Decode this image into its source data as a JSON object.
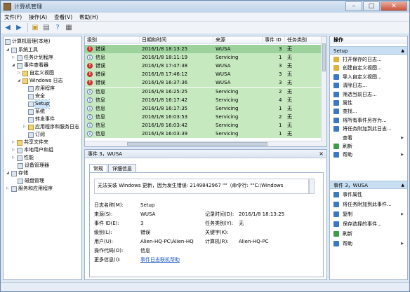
{
  "window": {
    "title": "计算机管理",
    "min": "–",
    "max": "□",
    "close": "✕"
  },
  "menu": [
    "文件(F)",
    "操作(A)",
    "查看(V)",
    "帮助(H)"
  ],
  "toolbar": [
    "back-icon",
    "forward-icon",
    "up-folder-icon",
    "show-hide-tree-icon",
    "help-icon",
    "properties-icon"
  ],
  "tree": {
    "root": "计算机管理(本地)",
    "system_tools": "系统工具",
    "task_scheduler": "任务计划程序",
    "event_viewer": "事件查看器",
    "custom_views": "自定义视图",
    "windows_logs": "Windows 日志",
    "application": "应用程序",
    "security": "安全",
    "setup": "Setup",
    "system": "系统",
    "forwarded": "转发事件",
    "app_service_logs": "应用程序和服务日志",
    "subscriptions": "订阅",
    "shared_folders": "共享文件夹",
    "local_users": "本地用户和组",
    "performance": "性能",
    "device_manager": "设备管理器",
    "storage": "存储",
    "disk_management": "磁盘管理",
    "services_apps": "服务和应用程序"
  },
  "events": {
    "columns": [
      "级别",
      "日期和时间",
      "来源",
      "事件 ID",
      "任务类别"
    ],
    "rows": [
      {
        "level": "错误",
        "kind": "err",
        "time": "2016/1/8 18:13:25",
        "source": "WUSA",
        "id": "3",
        "task": "无",
        "selected": true
      },
      {
        "level": "信息",
        "kind": "info",
        "time": "2016/1/8 18:11:19",
        "source": "Servicing",
        "id": "1",
        "task": "无"
      },
      {
        "level": "错误",
        "kind": "err",
        "time": "2016/1/8 17:47:38",
        "source": "WUSA",
        "id": "3",
        "task": "无"
      },
      {
        "level": "错误",
        "kind": "err",
        "time": "2016/1/8 17:46:12",
        "source": "WUSA",
        "id": "3",
        "task": "无"
      },
      {
        "level": "错误",
        "kind": "err",
        "time": "2016/1/8 16:37:36",
        "source": "WUSA",
        "id": "3",
        "task": "无"
      },
      {
        "level": "信息",
        "kind": "info",
        "time": "2016/1/8 16:25:25",
        "source": "Servicing",
        "id": "2",
        "task": "无"
      },
      {
        "level": "信息",
        "kind": "info",
        "time": "2016/1/8 16:17:42",
        "source": "Servicing",
        "id": "4",
        "task": "无"
      },
      {
        "level": "信息",
        "kind": "info",
        "time": "2016/1/8 16:17:35",
        "source": "Servicing",
        "id": "1",
        "task": "无"
      },
      {
        "level": "信息",
        "kind": "info",
        "time": "2016/1/8 16:03:53",
        "source": "Servicing",
        "id": "2",
        "task": "无"
      },
      {
        "level": "信息",
        "kind": "info",
        "time": "2016/1/8 16:03:42",
        "source": "Servicing",
        "id": "1",
        "task": "无"
      },
      {
        "level": "信息",
        "kind": "info",
        "time": "2016/1/8 16:03:39",
        "source": "Servicing",
        "id": "1",
        "task": "无"
      }
    ]
  },
  "detail": {
    "title": "事件 3，WUSA",
    "close": "×",
    "tabs": [
      "常规",
      "详细信息"
    ],
    "message": "无法安装 Windows 更新，因为发生错误: 2149842967 \"\"（命令行: \"\"C:\\Windows",
    "labels": {
      "log_name": "日志名称(M):",
      "source": "来源(S):",
      "event_id": "事件 ID(E):",
      "level": "级别(L):",
      "user": "用户(U):",
      "opcode": "操作代码(O):",
      "more_info": "更多信息(I):",
      "logged": "记录时间(D):",
      "task": "任务类别(Y):",
      "keywords": "关键字(K):",
      "computer": "计算机(R):"
    },
    "values": {
      "log_name": "Setup",
      "source": "WUSA",
      "event_id": "3",
      "level": "错误",
      "user": "Alien-HQ-PC\\Alien-HQ",
      "opcode": "信息",
      "more_info": "事件日志联机帮助",
      "logged": "2016/1/8 18:13:25",
      "task": "无",
      "keywords": "",
      "computer": "Alien-HQ-PC"
    }
  },
  "actions": {
    "header": "操作",
    "section1": "Setup",
    "items1": [
      "打开保存的日志...",
      "创建自定义视图...",
      "导入自定义视图...",
      "清除日志...",
      "筛选当前日志...",
      "属性",
      "查找...",
      "将所有事件另存为...",
      "将任务附加到此日志...",
      "查看",
      "刷新",
      "帮助"
    ],
    "section2": "事件 3，WUSA",
    "items2": [
      "事件属性",
      "将任务附加到此事件...",
      "复制",
      "保存选择的事件...",
      "刷新",
      "帮助"
    ],
    "colors": {
      "blue": "#3a78c3",
      "green": "#3f9b48",
      "red": "#c9302c",
      "yellow": "#e0b13a"
    }
  }
}
